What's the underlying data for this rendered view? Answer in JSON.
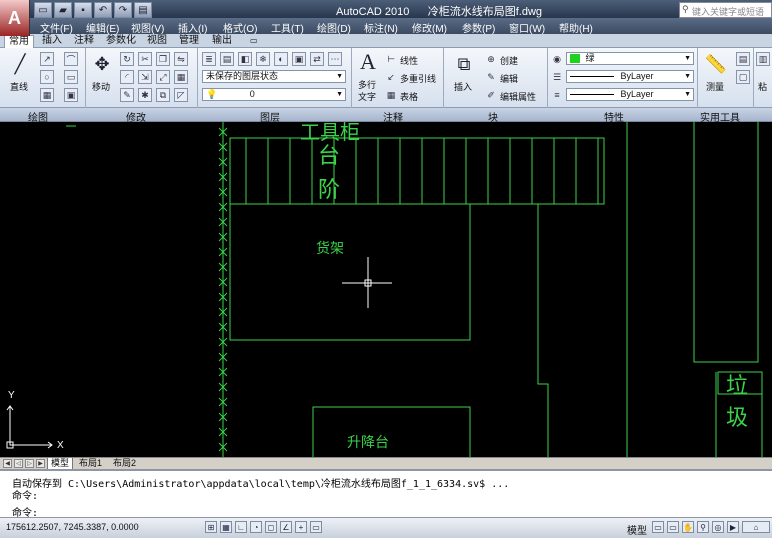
{
  "titlebar": {
    "app_name": "AutoCAD 2010",
    "file_name": "冷柜流水线布局图f.dwg",
    "search_placeholder": "键入关键字或短语"
  },
  "menu": [
    "文件(F)",
    "编辑(E)",
    "视图(V)",
    "插入(I)",
    "格式(O)",
    "工具(T)",
    "绘图(D)",
    "标注(N)",
    "修改(M)",
    "参数(P)",
    "窗口(W)",
    "帮助(H)"
  ],
  "ribbon_tabs": [
    "常用",
    "插入",
    "注释",
    "参数化",
    "视图",
    "管理",
    "输出"
  ],
  "ribbon": {
    "draw": {
      "line_label": "直线"
    },
    "modify": {
      "move_label": "移动"
    },
    "layers": {
      "state_combo": "未保存的图层状态",
      "layer_combo": "0"
    },
    "annotation": {
      "mtext_label": "多行",
      "mtext_label2": "文字",
      "linear_label": "线性",
      "multileader_label": "多重引线",
      "table_label": "表格"
    },
    "block": {
      "insert_label": "插入",
      "create_label": "创建",
      "edit_label": "编辑",
      "attr_label": "编辑属性"
    },
    "properties": {
      "color_combo": "绿",
      "linetype_combo": "ByLayer",
      "lineweight_combo": "ByLayer"
    },
    "utilities": {
      "measure_label": "测量"
    },
    "clipboard": {
      "paste_label": "粘"
    }
  },
  "panel_labels": [
    "绘图",
    "修改",
    "图层",
    "注释",
    "块",
    "特性",
    "实用工具"
  ],
  "drawing": {
    "label_cabinet": "工具柜",
    "label_steps_1": "台",
    "label_steps_2": "阶",
    "label_shelf": "货架",
    "label_lift": "升降台",
    "label_trash_1": "垃",
    "label_trash_2": "圾",
    "ucs_x": "X",
    "ucs_y": "Y",
    "line_color": "#3bd24a"
  },
  "layout_tabs": [
    "模型",
    "布局1",
    "布局2"
  ],
  "command": {
    "line1": "自动保存到 C:\\Users\\Administrator\\appdata\\local\\temp\\冷柜流水线布局图f_1_1_6334.sv$ ...",
    "line2": "命令:",
    "line3": "命令:"
  },
  "status": {
    "coords": "175612.2507, 7245.3387, 0.0000",
    "model_label": "模型"
  }
}
